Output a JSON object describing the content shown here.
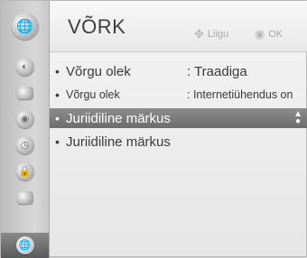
{
  "header": {
    "title": "VÕRK",
    "move_hint": "Liigu",
    "ok_hint": "OK",
    "move_icon": "four-arrows-icon",
    "ok_icon": "ok-button-icon"
  },
  "sidebar": {
    "main_icon": "globe-network-icon",
    "items": [
      {
        "icon": "picture-icon"
      },
      {
        "icon": "monitor-icon"
      },
      {
        "icon": "speaker-icon"
      },
      {
        "icon": "clock-icon"
      },
      {
        "icon": "lock-icon"
      },
      {
        "icon": "settings-icon"
      },
      {
        "icon": "network-icon",
        "active": true
      }
    ]
  },
  "rows": [
    {
      "bullet": "•",
      "name": "Võrgu olek",
      "value": ": Traadiga"
    },
    {
      "bullet": "•",
      "name": "Võrgu olek",
      "value": ": Internetiühendus on"
    },
    {
      "bullet": "•",
      "name": "Juriidiline märkus",
      "value": ""
    },
    {
      "bullet": "•",
      "name": "Juriidiline märkus",
      "value": ""
    }
  ],
  "colors": {
    "selection": "#7c7c7c",
    "text": "#3a3a3a"
  }
}
